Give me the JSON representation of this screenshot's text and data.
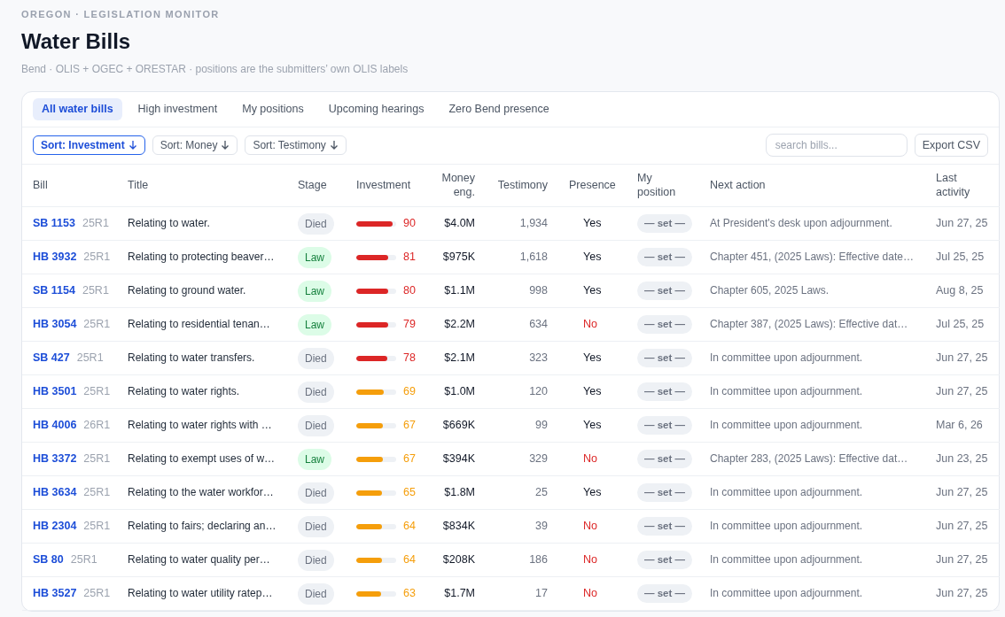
{
  "header": {
    "eyebrow": "OREGON · LEGISLATION MONITOR",
    "title": "Water Bills",
    "subtitle": "Bend · OLIS + OGEC + ORESTAR · positions are the submitters’ own OLIS labels"
  },
  "tabs": [
    {
      "label": "All water bills",
      "selected": true
    },
    {
      "label": "High investment",
      "selected": false
    },
    {
      "label": "My positions",
      "selected": false
    },
    {
      "label": "Upcoming hearings",
      "selected": false
    },
    {
      "label": "Zero Bend presence",
      "selected": false
    }
  ],
  "sort_buttons": [
    {
      "label": "Sort: Investment",
      "selected": true
    },
    {
      "label": "Sort: Money",
      "selected": false
    },
    {
      "label": "Sort: Testimony",
      "selected": false
    }
  ],
  "search": {
    "placeholder": "search bills..."
  },
  "export_button": "Export CSV",
  "table": {
    "columns": [
      "Bill",
      "Title",
      "Stage",
      "Investment",
      "Money eng.",
      "Testimony",
      "Presence",
      "My position",
      "Next action",
      "Last activity"
    ],
    "rows": [
      {
        "bill": "SB 1153",
        "session": "25R1",
        "title": "Relating to water.",
        "stage": {
          "label": "Died",
          "kind": "died"
        },
        "investment": {
          "level": 0.9,
          "score": "90",
          "color": "#dc2626"
        },
        "money": "$4.0M",
        "testimony": "1,934",
        "presence": "Yes",
        "present": true,
        "position": "— set —",
        "next_action": "At President's desk upon adjournment.",
        "last_activity": "Jun 27, 25"
      },
      {
        "bill": "HB 3932",
        "session": "25R1",
        "title": "Relating to protecting beaver…",
        "stage": {
          "label": "Law",
          "kind": "law"
        },
        "investment": {
          "level": 0.81,
          "score": "81",
          "color": "#dc2626"
        },
        "money": "$975K",
        "testimony": "1,618",
        "presence": "Yes",
        "present": true,
        "position": "— set —",
        "next_action": "Chapter 451, (2025 Laws): Effective date…",
        "last_activity": "Jul 25, 25"
      },
      {
        "bill": "SB 1154",
        "session": "25R1",
        "title": "Relating to ground water.",
        "stage": {
          "label": "Law",
          "kind": "law"
        },
        "investment": {
          "level": 0.8,
          "score": "80",
          "color": "#dc2626"
        },
        "money": "$1.1M",
        "testimony": "998",
        "presence": "Yes",
        "present": true,
        "position": "— set —",
        "next_action": "Chapter 605, 2025 Laws.",
        "last_activity": "Aug 8, 25"
      },
      {
        "bill": "HB 3054",
        "session": "25R1",
        "title": "Relating to residential tenan…",
        "stage": {
          "label": "Law",
          "kind": "law"
        },
        "investment": {
          "level": 0.79,
          "score": "79",
          "color": "#dc2626"
        },
        "money": "$2.2M",
        "testimony": "634",
        "presence": "No",
        "present": false,
        "position": "— set —",
        "next_action": "Chapter 387, (2025 Laws): Effective dat…",
        "last_activity": "Jul 25, 25"
      },
      {
        "bill": "SB 427",
        "session": "25R1",
        "title": "Relating to water transfers.",
        "stage": {
          "label": "Died",
          "kind": "died"
        },
        "investment": {
          "level": 0.78,
          "score": "78",
          "color": "#dc2626"
        },
        "money": "$2.1M",
        "testimony": "323",
        "presence": "Yes",
        "present": true,
        "position": "— set —",
        "next_action": "In committee upon adjournment.",
        "last_activity": "Jun 27, 25"
      },
      {
        "bill": "HB 3501",
        "session": "25R1",
        "title": "Relating to water rights.",
        "stage": {
          "label": "Died",
          "kind": "died"
        },
        "investment": {
          "level": 0.69,
          "score": "69",
          "color": "#f59e0b"
        },
        "money": "$1.0M",
        "testimony": "120",
        "presence": "Yes",
        "present": true,
        "position": "— set —",
        "next_action": "In committee upon adjournment.",
        "last_activity": "Jun 27, 25"
      },
      {
        "bill": "HB 4006",
        "session": "26R1",
        "title": "Relating to water rights with …",
        "stage": {
          "label": "Died",
          "kind": "died"
        },
        "investment": {
          "level": 0.67,
          "score": "67",
          "color": "#f59e0b"
        },
        "money": "$669K",
        "testimony": "99",
        "presence": "Yes",
        "present": true,
        "position": "— set —",
        "next_action": "In committee upon adjournment.",
        "last_activity": "Mar 6, 26"
      },
      {
        "bill": "HB 3372",
        "session": "25R1",
        "title": "Relating to exempt uses of w…",
        "stage": {
          "label": "Law",
          "kind": "law"
        },
        "investment": {
          "level": 0.67,
          "score": "67",
          "color": "#f59e0b"
        },
        "money": "$394K",
        "testimony": "329",
        "presence": "No",
        "present": false,
        "position": "— set —",
        "next_action": "Chapter 283, (2025 Laws): Effective dat…",
        "last_activity": "Jun 23, 25"
      },
      {
        "bill": "HB 3634",
        "session": "25R1",
        "title": "Relating to the water workfor…",
        "stage": {
          "label": "Died",
          "kind": "died"
        },
        "investment": {
          "level": 0.65,
          "score": "65",
          "color": "#f59e0b"
        },
        "money": "$1.8M",
        "testimony": "25",
        "presence": "Yes",
        "present": true,
        "position": "— set —",
        "next_action": "In committee upon adjournment.",
        "last_activity": "Jun 27, 25"
      },
      {
        "bill": "HB 2304",
        "session": "25R1",
        "title": "Relating to fairs; declaring an…",
        "stage": {
          "label": "Died",
          "kind": "died"
        },
        "investment": {
          "level": 0.64,
          "score": "64",
          "color": "#f59e0b"
        },
        "money": "$834K",
        "testimony": "39",
        "presence": "No",
        "present": false,
        "position": "— set —",
        "next_action": "In committee upon adjournment.",
        "last_activity": "Jun 27, 25"
      },
      {
        "bill": "SB 80",
        "session": "25R1",
        "title": "Relating to water quality per…",
        "stage": {
          "label": "Died",
          "kind": "died"
        },
        "investment": {
          "level": 0.64,
          "score": "64",
          "color": "#f59e0b"
        },
        "money": "$208K",
        "testimony": "186",
        "presence": "No",
        "present": false,
        "position": "— set —",
        "next_action": "In committee upon adjournment.",
        "last_activity": "Jun 27, 25"
      },
      {
        "bill": "HB 3527",
        "session": "25R1",
        "title": "Relating to water utility ratep…",
        "stage": {
          "label": "Died",
          "kind": "died"
        },
        "investment": {
          "level": 0.63,
          "score": "63",
          "color": "#f59e0b"
        },
        "money": "$1.7M",
        "testimony": "17",
        "presence": "No",
        "present": false,
        "position": "— set —",
        "next_action": "In committee upon adjournment.",
        "last_activity": "Jun 27, 25"
      }
    ]
  }
}
